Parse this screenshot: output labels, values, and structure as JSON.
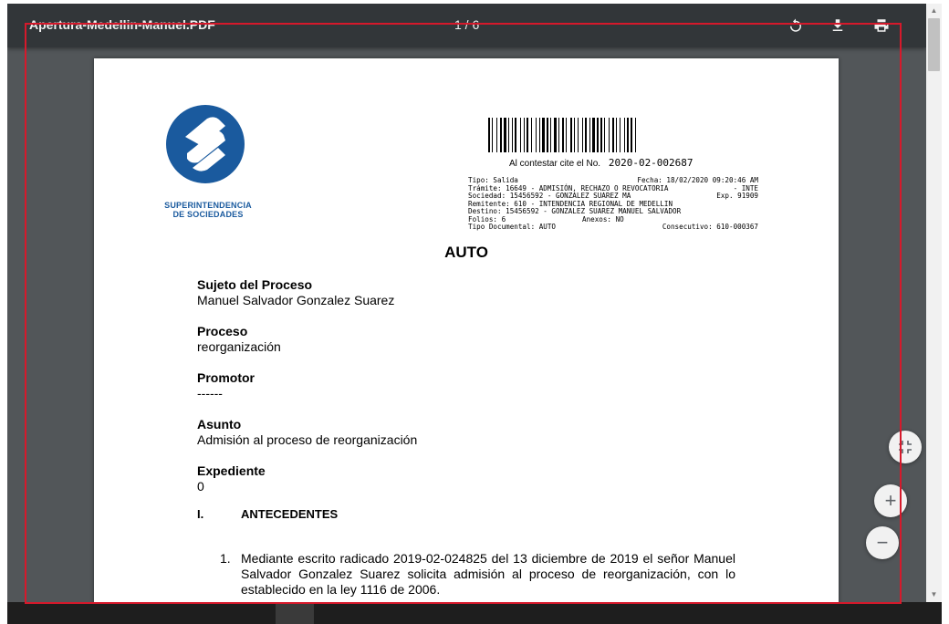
{
  "toolbar": {
    "title": "Apertura-Medellin-Manuel.PDF",
    "page_counter": "1 / 6",
    "icons": [
      "rotate-icon",
      "download-icon",
      "print-icon"
    ]
  },
  "document": {
    "logo": {
      "line1": "SUPERINTENDENCIA",
      "line2": "DE SOCIEDADES",
      "color": "#1a5a9e"
    },
    "cite_label": "Al contestar cite el No.",
    "cite_number": "2020-02-002687",
    "meta": [
      [
        "Tipo: Salida",
        "Fecha: 18/02/2020 09:20:46 AM"
      ],
      [
        "Trámite: 16649 - ADMISIÓN, RECHAZO O REVOCATORIA",
        "- INTE"
      ],
      [
        "Sociedad: 15456592 - GONZALEZ SUAREZ MA",
        "Exp. 91909"
      ],
      [
        "Remitente: 610 - INTENDENCIA REGIONAL DE MEDELLIN",
        ""
      ],
      [
        "Destino: 15456592 - GONZALEZ SUAREZ MANUEL SALVADOR",
        ""
      ],
      [
        "Folios: 6",
        "Anexos: NO"
      ],
      [
        "Tipo Documental: AUTO",
        "Consecutivo: 610-000367"
      ]
    ],
    "heading": "AUTO",
    "fields": [
      {
        "label": "Sujeto del Proceso",
        "value": "Manuel Salvador Gonzalez Suarez"
      },
      {
        "label": "Proceso",
        "value": "reorganización"
      },
      {
        "label": "Promotor",
        "value": "------"
      },
      {
        "label": "Asunto",
        "value": "Admisión al proceso de reorganización"
      },
      {
        "label": "Expediente",
        "value": "0"
      }
    ],
    "section": {
      "number": "I.",
      "title": "ANTECEDENTES"
    },
    "paragraph": {
      "number": "1.",
      "text": "Mediante escrito radicado 2019-02-024825 del 13 diciembre de 2019 el señor Manuel Salvador Gonzalez Suarez solicita admisión al proceso de reorganización, con lo establecido en la ley 1116 de 2006."
    }
  },
  "controls": {
    "fit_icon": "fit-to-page-icon",
    "zoom_in": "+",
    "zoom_out": "−"
  },
  "colors": {
    "toolbar": "#323639",
    "viewer_bg": "#525659",
    "outline": "#d6192b"
  }
}
